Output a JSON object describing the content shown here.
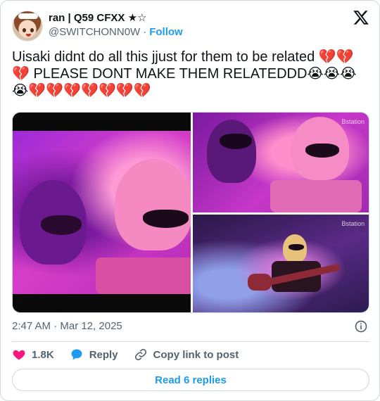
{
  "author": {
    "display_name": "ran | Q59 CFXX ★☆",
    "handle": "@SWITCHONN0W",
    "separator": "·",
    "follow_label": "Follow"
  },
  "tweet": {
    "text": "Uisaki didnt do all this jjust for them to be related 💔💔💔 PLEASE DONT MAKE THEM RELATEDDD😭😭😭😭💔💔💔💔💔💔💔",
    "timestamp": "2:47 AM · Mar 12, 2025"
  },
  "media": {
    "watermark_2": "Bstation",
    "watermark_3": "Bstation"
  },
  "actions": {
    "likes_count": "1.8K",
    "reply_label": "Reply",
    "copy_link_label": "Copy link to post"
  },
  "read_replies_label": "Read 6 replies",
  "colors": {
    "accent": "#1d9bf0",
    "like": "#f91880",
    "text": "#0f1419",
    "muted": "#536471",
    "border": "#cfd9de"
  },
  "icons": [
    "x-logo-icon",
    "info-icon",
    "heart-icon",
    "reply-bubble-icon",
    "link-icon"
  ]
}
